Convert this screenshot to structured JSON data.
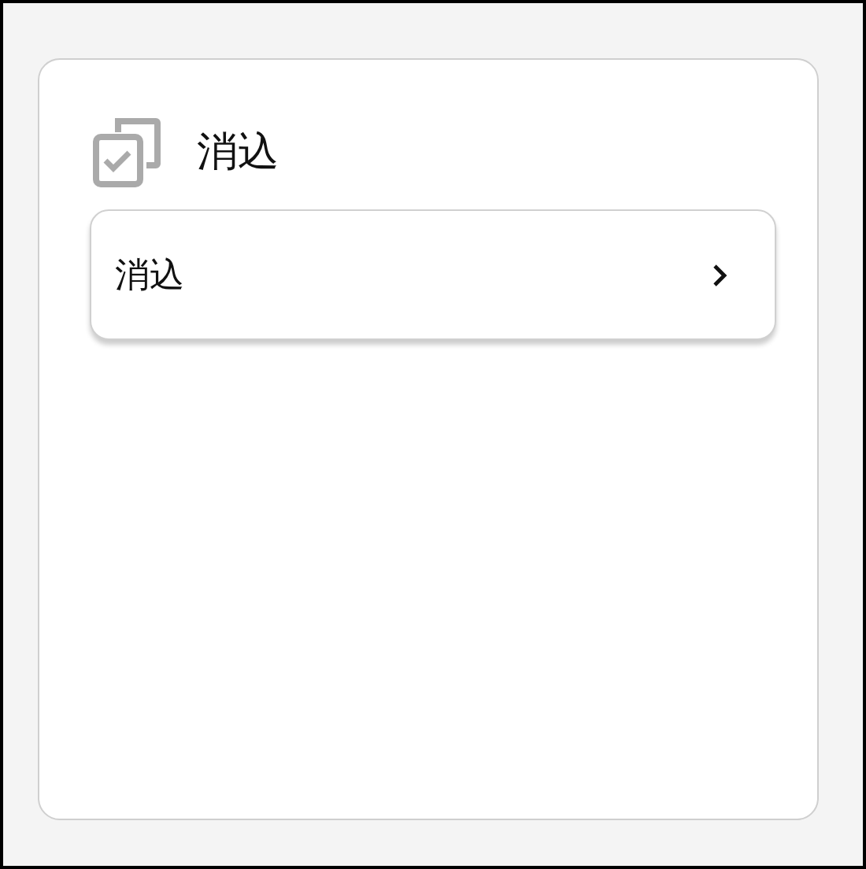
{
  "card": {
    "title": "消込",
    "items": [
      {
        "label": "消込"
      }
    ]
  }
}
